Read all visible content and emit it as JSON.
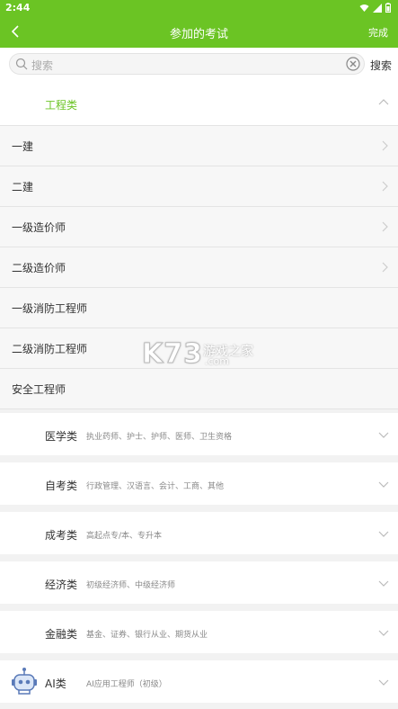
{
  "status": {
    "time": "2:44"
  },
  "header": {
    "title": "参加的考试",
    "done_label": "完成"
  },
  "search": {
    "placeholder": "搜索",
    "button_label": "搜索"
  },
  "expanded_group": {
    "name": "工程类",
    "items": [
      {
        "label": "一建",
        "has_arrow": true
      },
      {
        "label": "二建",
        "has_arrow": true
      },
      {
        "label": "一级造价师",
        "has_arrow": true
      },
      {
        "label": "二级造价师",
        "has_arrow": true
      },
      {
        "label": "一级消防工程师",
        "has_arrow": false
      },
      {
        "label": "二级消防工程师",
        "has_arrow": false
      },
      {
        "label": "安全工程师",
        "has_arrow": false
      }
    ]
  },
  "groups": [
    {
      "name": "医学类",
      "desc": "执业药师、护士、护师、医师、卫生资格"
    },
    {
      "name": "自考类",
      "desc": "行政管理、汉语言、会计、工商、其他"
    },
    {
      "name": "成考类",
      "desc": "高起点专/本、专升本"
    },
    {
      "name": "经济类",
      "desc": "初级经济师、中级经济师"
    },
    {
      "name": "金融类",
      "desc": "基金、证券、银行从业、期货从业"
    },
    {
      "name": "AI类",
      "desc": "AI应用工程师（初级）",
      "icon": "robot-icon"
    }
  ],
  "watermark": {
    "logo": "K73",
    "site": "游戏之家",
    "domain": ".com"
  },
  "colors": {
    "brand": "#6bc424",
    "group_selected": "#6bc424"
  }
}
